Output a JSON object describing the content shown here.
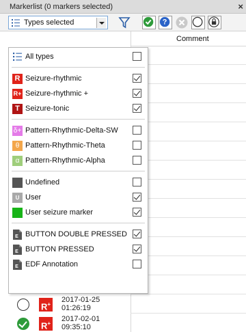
{
  "window": {
    "title": "Markerlist (0 markers selected)",
    "close_glyph": "×"
  },
  "toolbar": {
    "type_combo": "Types selected",
    "icons": [
      "filter-icon",
      "accept-check-icon",
      "question-icon",
      "reject-x-icon",
      "empty-circle-icon",
      "lock-icon"
    ]
  },
  "table": {
    "comment_header": "Comment",
    "rows": [
      {
        "status": "empty-circle",
        "type_badge": "R",
        "type_badge_sup": "+",
        "date": "2017-01-25",
        "time": "01:26:19"
      },
      {
        "status": "accepted",
        "type_badge": "R",
        "type_badge_sup": "+",
        "date": "2017-02-01",
        "time": "09:35:10"
      }
    ]
  },
  "dropdown": {
    "options": [
      {
        "label": "All types",
        "icon": "list-icon",
        "icon_text": "",
        "color": "",
        "checked": false
      },
      {
        "label": "Seizure-rhythmic",
        "icon": "seizure-rhythmic-icon",
        "icon_text": "R",
        "color": "#e0231a",
        "checked": true
      },
      {
        "label": "Seizure-rhythmic +",
        "icon": "seizure-rhythmic-plus-icon",
        "icon_text": "R+",
        "color": "#e0231a",
        "checked": true
      },
      {
        "label": "Seizure-tonic",
        "icon": "seizure-tonic-icon",
        "icon_text": "T",
        "color": "#b01414",
        "checked": true
      },
      {
        "label": "Pattern-Rhythmic-Delta-SW",
        "icon": "delta-sw-icon",
        "icon_text": "δ+",
        "color": "#e47be8",
        "checked": false
      },
      {
        "label": "Pattern-Rhythmic-Theta",
        "icon": "theta-icon",
        "icon_text": "θ",
        "color": "#f3a64b",
        "checked": false
      },
      {
        "label": "Pattern-Rhythmic-Alpha",
        "icon": "alpha-icon",
        "icon_text": "α",
        "color": "#9fce7b",
        "checked": false
      },
      {
        "label": "Undefined",
        "icon": "undefined-icon",
        "icon_text": "",
        "color": "#555555",
        "checked": false
      },
      {
        "label": "User",
        "icon": "user-icon",
        "icon_text": "U",
        "color": "#a9a9a9",
        "checked": true
      },
      {
        "label": "User seizure marker",
        "icon": "user-seizure-icon",
        "icon_text": "",
        "color": "#18b418",
        "checked": true
      },
      {
        "label": "BUTTON DOUBLE PRESSED",
        "icon": "edf-file-icon",
        "icon_text": "E",
        "color": "#555555",
        "checked": true
      },
      {
        "label": "BUTTON PRESSED",
        "icon": "edf-file-icon",
        "icon_text": "E",
        "color": "#555555",
        "checked": true
      },
      {
        "label": "EDF Annotation",
        "icon": "edf-file-icon",
        "icon_text": "E",
        "color": "#555555",
        "checked": false
      }
    ]
  }
}
